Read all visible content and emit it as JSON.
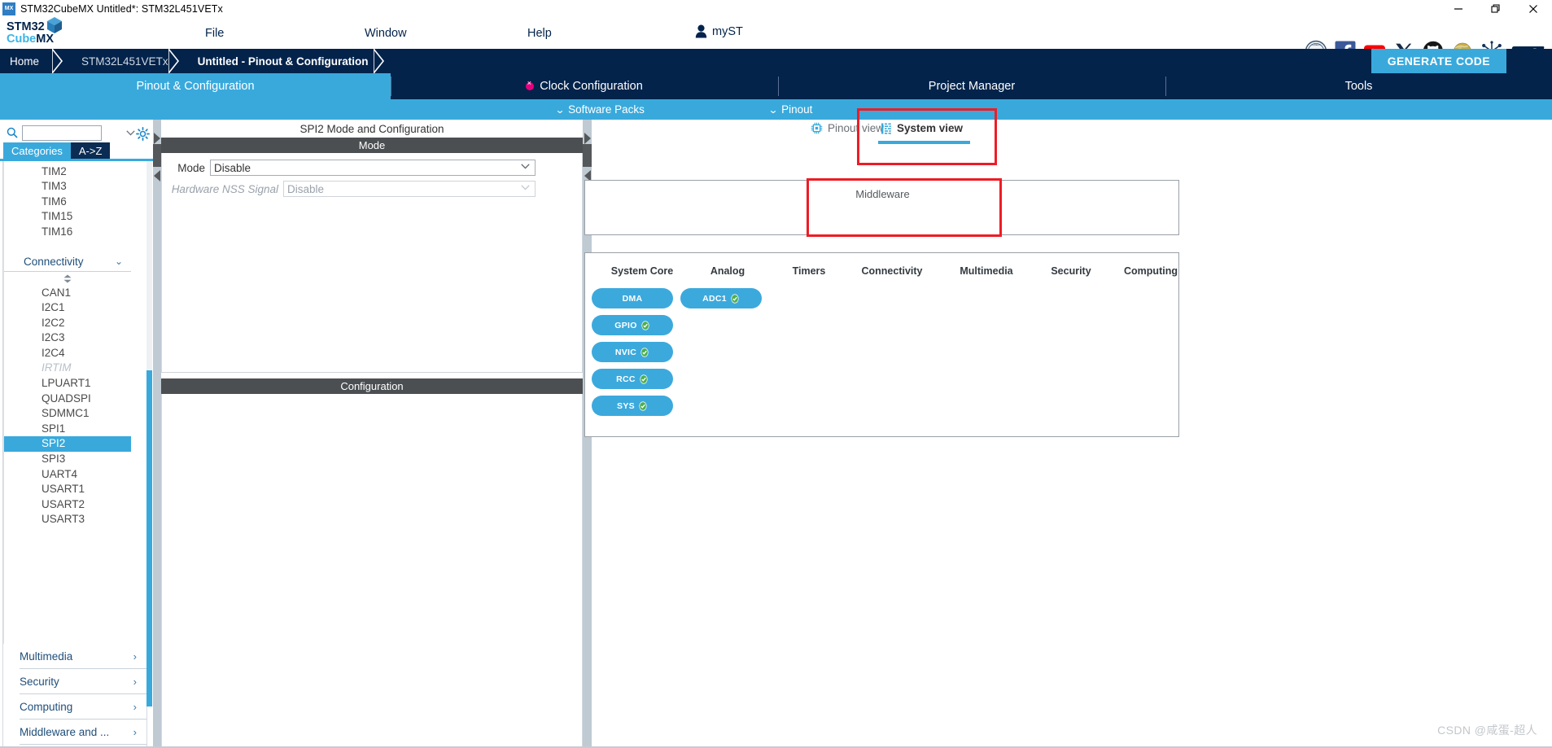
{
  "window": {
    "title": "STM32CubeMX Untitled*: STM32L451VETx",
    "app_icon": "stm32cubemx-icon",
    "controls": {
      "minimize": "minimize-icon",
      "maximize": "maximize-icon",
      "close": "close-icon"
    }
  },
  "logo": {
    "line1_bold": "STM32",
    "line1_light": "",
    "line2_bold": "Cube",
    "line2_dark": "MX"
  },
  "menu": {
    "items": [
      {
        "label": "File",
        "name": "menu-file"
      },
      {
        "label": "Window",
        "name": "menu-window"
      },
      {
        "label": "Help",
        "name": "menu-help"
      }
    ],
    "account": "myST"
  },
  "social_icons": [
    "ten-years-badge-icon",
    "facebook-icon",
    "youtube-icon",
    "x-twitter-icon",
    "github-icon",
    "wikipedia-icon",
    "community-network-icon",
    "st-logo-icon"
  ],
  "breadcrumb": {
    "items": [
      {
        "label": "Home",
        "active": false
      },
      {
        "label": "STM32L451VETx",
        "active": false
      },
      {
        "label": "Untitled - Pinout & Configuration",
        "active": true
      }
    ],
    "generate_code": "GENERATE CODE"
  },
  "main_tabs": [
    {
      "label": "Pinout & Configuration",
      "active": true,
      "error": false
    },
    {
      "label": "Clock Configuration",
      "active": false,
      "error": true
    },
    {
      "label": "Project Manager",
      "active": false,
      "error": false
    },
    {
      "label": "Tools",
      "active": false,
      "error": false
    }
  ],
  "sub_bar": [
    {
      "label": "Software Packs"
    },
    {
      "label": "Pinout"
    }
  ],
  "left_panel": {
    "search": {
      "value": "",
      "placeholder": ""
    },
    "gear": "gear-icon",
    "tabs": [
      {
        "label": "Categories",
        "selected": true
      },
      {
        "label": "A->Z",
        "selected": false
      }
    ],
    "timer_items": [
      {
        "label": "TIM2",
        "state": "normal"
      },
      {
        "label": "TIM3",
        "state": "normal"
      },
      {
        "label": "TIM6",
        "state": "normal"
      },
      {
        "label": "TIM15",
        "state": "normal"
      },
      {
        "label": "TIM16",
        "state": "normal"
      }
    ],
    "connectivity_group": "Connectivity",
    "connectivity_items": [
      {
        "label": "CAN1",
        "state": "normal"
      },
      {
        "label": "I2C1",
        "state": "normal"
      },
      {
        "label": "I2C2",
        "state": "normal"
      },
      {
        "label": "I2C3",
        "state": "normal"
      },
      {
        "label": "I2C4",
        "state": "normal"
      },
      {
        "label": "IRTIM",
        "state": "disabled"
      },
      {
        "label": "LPUART1",
        "state": "normal"
      },
      {
        "label": "QUADSPI",
        "state": "normal"
      },
      {
        "label": "SDMMC1",
        "state": "normal"
      },
      {
        "label": "SPI1",
        "state": "normal"
      },
      {
        "label": "SPI2",
        "state": "selected"
      },
      {
        "label": "SPI3",
        "state": "normal"
      },
      {
        "label": "UART4",
        "state": "normal"
      },
      {
        "label": "USART1",
        "state": "normal"
      },
      {
        "label": "USART2",
        "state": "normal"
      },
      {
        "label": "USART3",
        "state": "normal"
      }
    ],
    "bottom_categories": [
      {
        "label": "Multimedia"
      },
      {
        "label": "Security"
      },
      {
        "label": "Computing"
      },
      {
        "label": "Middleware and ..."
      }
    ]
  },
  "mid_panel": {
    "title": "SPI2 Mode and Configuration",
    "mode_header": "Mode",
    "config_header": "Configuration",
    "rows": [
      {
        "label": "Mode",
        "value": "Disable",
        "disabled": false
      },
      {
        "label": "Hardware NSS Signal",
        "value": "Disable",
        "disabled": true
      }
    ]
  },
  "right_panel": {
    "view_tabs": [
      {
        "label": "Pinout view",
        "icon": "chip-icon",
        "active": false
      },
      {
        "label": "System view",
        "icon": "system-view-icon",
        "active": true
      }
    ],
    "middleware_label": "Middleware",
    "columns": [
      {
        "title": "System Core",
        "items": [
          {
            "label": "DMA",
            "configured": false
          },
          {
            "label": "GPIO",
            "configured": true
          },
          {
            "label": "NVIC",
            "configured": true
          },
          {
            "label": "RCC",
            "configured": true
          },
          {
            "label": "SYS",
            "configured": true
          }
        ]
      },
      {
        "title": "Analog",
        "items": [
          {
            "label": "ADC1",
            "configured": true
          }
        ]
      },
      {
        "title": "Timers",
        "items": []
      },
      {
        "title": "Connectivity",
        "items": []
      },
      {
        "title": "Multimedia",
        "items": []
      },
      {
        "title": "Security",
        "items": []
      },
      {
        "title": "Computing",
        "items": []
      }
    ]
  },
  "watermark": "CSDN @咸蛋-超人",
  "colors": {
    "brand_dark": "#03234b",
    "brand_blue": "#39a9dc",
    "pill_blue": "#3ca9dd",
    "error_pink": "#e6007e",
    "highlight_red": "#ee1c25",
    "header_gray": "#4c4f52"
  }
}
